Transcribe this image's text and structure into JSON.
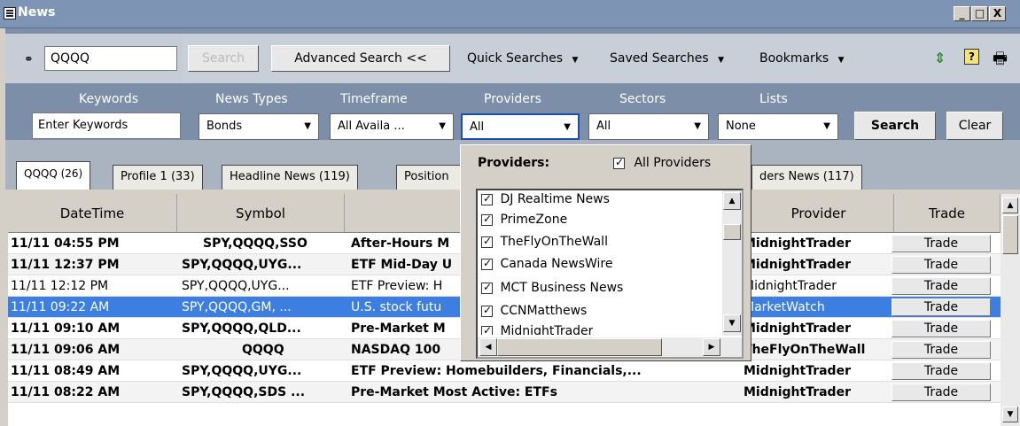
{
  "window": {
    "title": "News",
    "controls": [
      "_",
      "□",
      "X"
    ]
  },
  "search": {
    "symbol_value": "QQQQ",
    "search_button": "Search",
    "advanced_button": "Advanced Search <<",
    "quick_searches": "Quick Searches",
    "saved_searches": "Saved Searches",
    "bookmarks": "Bookmarks"
  },
  "filters": {
    "labels": {
      "keywords": "Keywords",
      "news_types": "News Types",
      "timeframe": "Timeframe",
      "providers": "Providers",
      "sectors": "Sectors",
      "lists": "Lists"
    },
    "keywords_value": "Enter Keywords",
    "news_types_value": "Bonds",
    "timeframe_value": "All Availa ...",
    "providers_value": "All",
    "sectors_value": "All",
    "lists_value": "None",
    "search_button": "Search",
    "clear_button": "Clear"
  },
  "tabs": [
    {
      "label": "QQQQ (26)"
    },
    {
      "label": "Profile 1 (33)"
    },
    {
      "label": "Headline News (119)"
    },
    {
      "label": "Position"
    },
    {
      "label": "ders News (117)"
    }
  ],
  "grid": {
    "columns": [
      "DateTime",
      "Symbol",
      "",
      "Provider",
      "Trade"
    ],
    "rows": [
      {
        "datetime": "11/11 04:55 PM",
        "symbol": "SPY,QQQQ,SSO",
        "headline": "After-Hours M",
        "provider": "MidnightTrader",
        "trade": "Trade"
      },
      {
        "datetime": "11/11 12:37 PM",
        "symbol": "SPY,QQQQ,UYG...",
        "headline": "ETF Mid-Day U",
        "provider": "MidnightTrader",
        "trade": "Trade"
      },
      {
        "datetime": "11/11 12:12 PM",
        "symbol": "SPY,QQQQ,UYG...",
        "headline": "ETF Preview: H",
        "provider": "MidnightTrader",
        "trade": "Trade"
      },
      {
        "datetime": "11/11 09:22 AM",
        "symbol": "SPY,QQQQ,GM, ...",
        "headline": "U.S. stock futu",
        "provider": "MarketWatch",
        "trade": "Trade"
      },
      {
        "datetime": "11/11 09:10 AM",
        "symbol": "SPY,QQQQ,QLD...",
        "headline": "Pre-Market M",
        "provider": "MidnightTrader",
        "trade": "Trade"
      },
      {
        "datetime": "11/11 09:06 AM",
        "symbol": "QQQQ",
        "headline": "NASDAQ 100",
        "provider": "TheFlyOnTheWall",
        "trade": "Trade"
      },
      {
        "datetime": "11/11 08:49 AM",
        "symbol": "SPY,QQQQ,UYG...",
        "headline": "ETF Preview: Homebuilders, Financials,...",
        "provider": "MidnightTrader",
        "trade": "Trade"
      },
      {
        "datetime": "11/11 08:22 AM",
        "symbol": "SPY,QQQQ,SDS ...",
        "headline": "Pre-Market Most Active: ETFs",
        "provider": "MidnightTrader",
        "trade": "Trade"
      }
    ]
  },
  "providers_popup": {
    "title": "Providers:",
    "all_providers_label": "All Providers",
    "all_providers_checked": true,
    "items": [
      {
        "label": "DJ Realtime News",
        "checked": true
      },
      {
        "label": "PrimeZone",
        "checked": true
      },
      {
        "label": "TheFlyOnTheWall",
        "checked": true
      },
      {
        "label": "Canada NewsWire",
        "checked": true
      },
      {
        "label": "MCT Business News",
        "checked": true
      },
      {
        "label": "CCNMatthews",
        "checked": true
      },
      {
        "label": "MidnightTrader",
        "checked": true
      }
    ]
  },
  "colors": {
    "titlebar": "#7e94b4",
    "toolbar": "#7c8ea8",
    "selection": "#3d7fe0"
  }
}
